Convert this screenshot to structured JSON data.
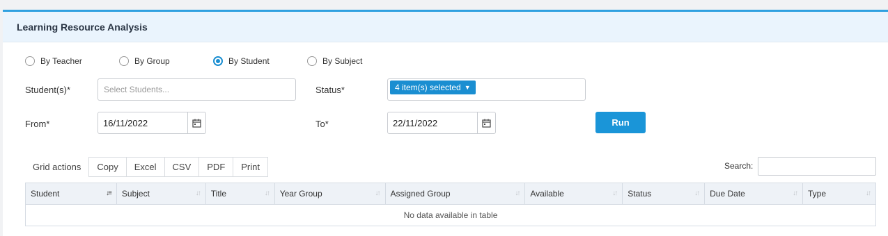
{
  "panel": {
    "title": "Learning Resource Analysis"
  },
  "radios": [
    {
      "label": "By Teacher",
      "checked": false
    },
    {
      "label": "By Group",
      "checked": false
    },
    {
      "label": "By Student",
      "checked": true
    },
    {
      "label": "By Subject",
      "checked": false
    }
  ],
  "form": {
    "students_label": "Student(s)*",
    "students_placeholder": "Select Students...",
    "status_label": "Status*",
    "status_selected": "4 item(s) selected",
    "from_label": "From*",
    "from_value": "16/11/2022",
    "to_label": "To*",
    "to_value": "22/11/2022",
    "run_label": "Run"
  },
  "grid": {
    "actions_label": "Grid actions",
    "buttons": [
      "Copy",
      "Excel",
      "CSV",
      "PDF",
      "Print"
    ],
    "search_label": "Search:",
    "columns": [
      "Student",
      "Subject",
      "Title",
      "Year Group",
      "Assigned Group",
      "Available",
      "Status",
      "Due Date",
      "Type"
    ],
    "empty_message": "No data available in table"
  },
  "colors": {
    "accent": "#1a8ed1",
    "header_bg": "#eaf4fd"
  }
}
